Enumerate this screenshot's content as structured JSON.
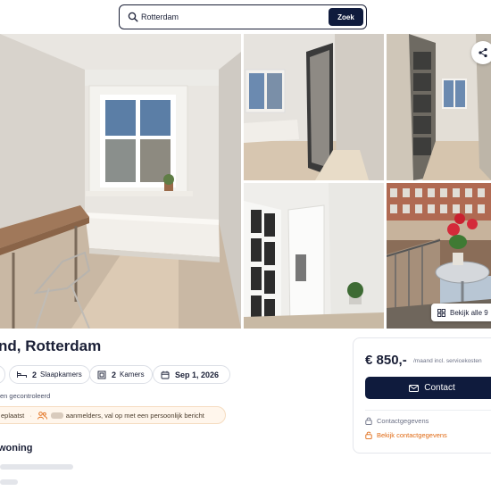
{
  "search": {
    "value": "Rotterdam",
    "button_label": "Zoek"
  },
  "gallery": {
    "all_photos_label": "Bekijk alle 9"
  },
  "listing": {
    "title": "nd, Rotterdam",
    "features": {
      "bedrooms_count": "2",
      "bedrooms_label": "Slaapkamers",
      "rooms_count": "2",
      "rooms_label": "Kamers",
      "available_date": "Sep 1, 2026"
    },
    "verified_text": "en gecontroleerd",
    "interest": {
      "placed_text": "eplaatst",
      "separator": "·",
      "message": "aanmelders, val op met een persoonlijk bericht"
    },
    "section_title": "woning"
  },
  "price_card": {
    "price": "€ 850,-",
    "price_suffix": "/maand incl. servicekosten",
    "contact_button": "Contact",
    "contact_details_label": "Contactgegevens",
    "view_contact_label": "Bekijk contactgegevens"
  },
  "colors": {
    "primary_dark": "#0f1b3d",
    "accent_orange": "#e06a14",
    "banner_bg": "#fff6ec"
  },
  "icons": [
    "search-icon",
    "share-icon",
    "grid-icon",
    "bed-icon",
    "door-icon",
    "calendar-icon",
    "people-icon",
    "mail-icon",
    "lock-icon",
    "lock-open-icon"
  ]
}
